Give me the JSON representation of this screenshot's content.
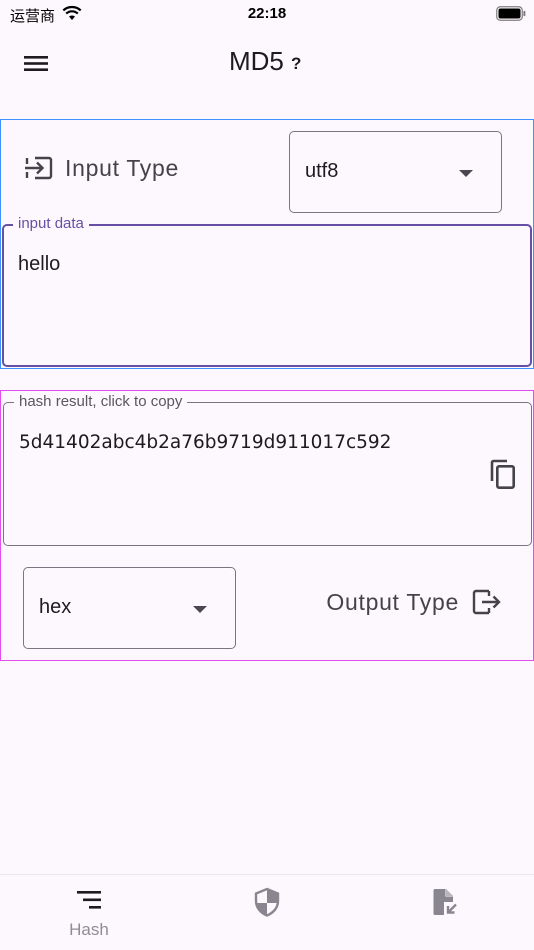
{
  "status_bar": {
    "carrier": "运营商",
    "time": "22:18"
  },
  "app_bar": {
    "title": "MD5",
    "help": "?",
    "menu_icon": "menu-icon"
  },
  "input": {
    "type_label": "Input Type",
    "type_icon": "login-icon",
    "encoding_selected": "utf8",
    "data_label": "input data",
    "data_value": "hello"
  },
  "output": {
    "result_label": "hash result, click to copy",
    "result_value": "5d41402abc4b2a76b9719d911017c592",
    "copy_icon": "copy-icon",
    "format_selected": "hex",
    "type_label": "Output Type",
    "type_icon": "logout-icon"
  },
  "bottom_nav": {
    "items": [
      {
        "label": "Hash",
        "icon": "hash-list-icon",
        "active": true
      },
      {
        "label": "",
        "icon": "shield-icon",
        "active": false
      },
      {
        "label": "",
        "icon": "file-import-icon",
        "active": false
      }
    ]
  },
  "colors": {
    "accent": "#6750a4",
    "input_frame": "#3d93ff",
    "output_frame": "#e14df0",
    "background": "#fdf8fd"
  }
}
